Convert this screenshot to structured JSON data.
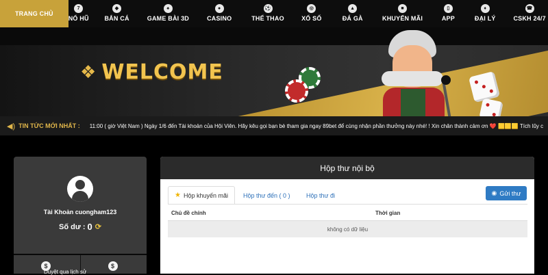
{
  "nav": {
    "items": [
      {
        "label": "TRANG CHỦ",
        "icon": "home-icon",
        "active": true
      },
      {
        "label": "NỔ HŨ",
        "icon": "slot-icon",
        "active": false
      },
      {
        "label": "BẮN CÁ",
        "icon": "fish-icon",
        "active": false
      },
      {
        "label": "GAME BÀI 3D",
        "icon": "cards-icon",
        "active": false
      },
      {
        "label": "CASINO",
        "icon": "casino-icon",
        "active": false
      },
      {
        "label": "THỂ THAO",
        "icon": "sports-icon",
        "active": false
      },
      {
        "label": "XỔ SỐ",
        "icon": "lottery-icon",
        "active": false
      },
      {
        "label": "ĐÁ GÀ",
        "icon": "rooster-icon",
        "active": false
      },
      {
        "label": "KHUYẾN MÃI",
        "icon": "gift-icon",
        "active": false
      },
      {
        "label": "APP",
        "icon": "app-icon",
        "active": false
      },
      {
        "label": "ĐẠI LÝ",
        "icon": "agent-icon",
        "active": false
      },
      {
        "label": "CSKH 24/7",
        "icon": "support-icon",
        "active": false
      }
    ]
  },
  "banner": {
    "welcome": "WELCOME"
  },
  "news": {
    "label": "TIN TỨC MỚI NHẤT :",
    "text": "11:00 ( giờ Việt Nam ) Ngày 1/6 đến Tài khoản của Hội Viên. Hãy kêu gọi bạn bè tham gia ngay 89bet để cùng nhận phần thưởng này nhé! ! Xin chân thành cảm ơn ❤️ 🟨🟨🟨 Tích lũy c"
  },
  "account": {
    "name": "Tài Khoản cuongham123",
    "balance_label": "Số dư :",
    "balance_value": "0",
    "action_label": "Duyệt qua lịch sử"
  },
  "inbox": {
    "title": "Hộp thư nội bộ",
    "tabs": [
      "Hộp khuyến mãi",
      "Hộp thư đến ( 0 )",
      "Hộp thư đi"
    ],
    "send_label": "Gửi thư",
    "columns": [
      "Chủ đề chính",
      "Thời gian"
    ],
    "empty": "không có dữ liệu"
  },
  "colors": {
    "accent_gold": "#c8a23a",
    "button_blue": "#2f7bc4"
  }
}
